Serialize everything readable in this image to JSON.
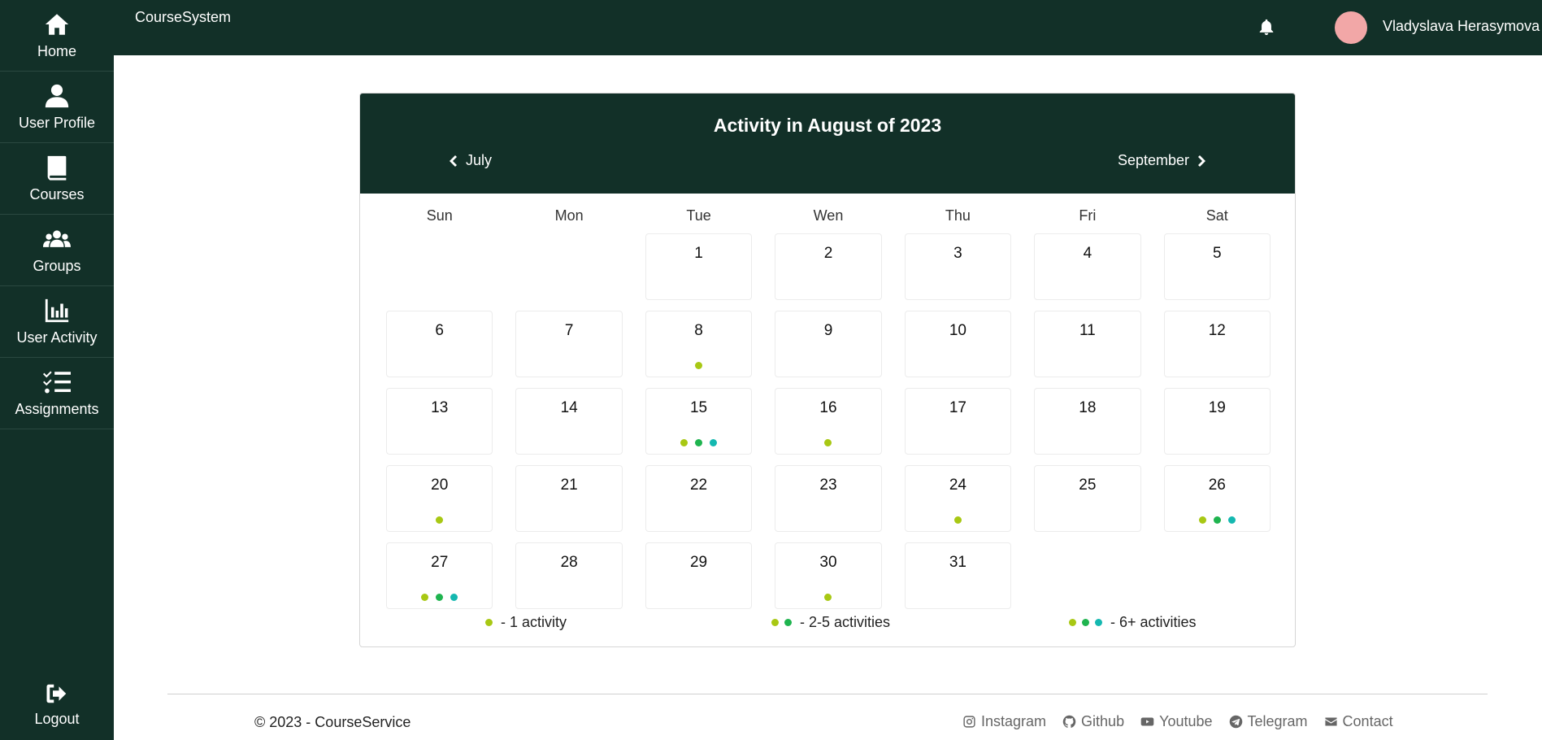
{
  "app": {
    "brand": "CourseSystem"
  },
  "sidebar": {
    "items": [
      {
        "label": "Home",
        "icon": "home-icon"
      },
      {
        "label": "User Profile",
        "icon": "user-icon"
      },
      {
        "label": "Courses",
        "icon": "book-icon"
      },
      {
        "label": "Groups",
        "icon": "users-icon"
      },
      {
        "label": "User Activity",
        "icon": "chart-icon"
      },
      {
        "label": "Assignments",
        "icon": "tasks-icon"
      }
    ],
    "logout": {
      "label": "Logout",
      "icon": "logout-icon"
    }
  },
  "header": {
    "user_name": "Vladyslava Herasymova",
    "bell_icon": "bell-icon"
  },
  "calendar": {
    "title": "Activity in August of 2023",
    "prev_month": "July",
    "next_month": "September",
    "weekdays": [
      "Sun",
      "Mon",
      "Tue",
      "Wen",
      "Thu",
      "Fri",
      "Sat"
    ],
    "leading_blank_days": 2,
    "days": [
      {
        "day": 1,
        "dots": 0
      },
      {
        "day": 2,
        "dots": 0
      },
      {
        "day": 3,
        "dots": 0
      },
      {
        "day": 4,
        "dots": 0
      },
      {
        "day": 5,
        "dots": 0
      },
      {
        "day": 6,
        "dots": 0
      },
      {
        "day": 7,
        "dots": 0
      },
      {
        "day": 8,
        "dots": 1
      },
      {
        "day": 9,
        "dots": 0
      },
      {
        "day": 10,
        "dots": 0
      },
      {
        "day": 11,
        "dots": 0
      },
      {
        "day": 12,
        "dots": 0
      },
      {
        "day": 13,
        "dots": 0
      },
      {
        "day": 14,
        "dots": 0
      },
      {
        "day": 15,
        "dots": 3
      },
      {
        "day": 16,
        "dots": 1
      },
      {
        "day": 17,
        "dots": 0
      },
      {
        "day": 18,
        "dots": 0
      },
      {
        "day": 19,
        "dots": 0
      },
      {
        "day": 20,
        "dots": 1
      },
      {
        "day": 21,
        "dots": 0
      },
      {
        "day": 22,
        "dots": 0
      },
      {
        "day": 23,
        "dots": 0
      },
      {
        "day": 24,
        "dots": 1
      },
      {
        "day": 25,
        "dots": 0
      },
      {
        "day": 26,
        "dots": 3
      },
      {
        "day": 27,
        "dots": 3
      },
      {
        "day": 28,
        "dots": 0
      },
      {
        "day": 29,
        "dots": 0
      },
      {
        "day": 30,
        "dots": 1
      },
      {
        "day": 31,
        "dots": 0
      }
    ],
    "dot_colors": [
      "#a8c814",
      "#1fb44f",
      "#14b8b0"
    ],
    "legend": [
      {
        "dots": 1,
        "text": "- 1 activity"
      },
      {
        "dots": 2,
        "text": "- 2-5 activities"
      },
      {
        "dots": 3,
        "text": "- 6+ activities"
      }
    ]
  },
  "footer": {
    "copyright": "© 2023 - CourseService",
    "links": [
      {
        "label": "Instagram",
        "icon": "instagram-icon"
      },
      {
        "label": "Github",
        "icon": "github-icon"
      },
      {
        "label": "Youtube",
        "icon": "youtube-icon"
      },
      {
        "label": "Telegram",
        "icon": "telegram-icon"
      },
      {
        "label": "Contact",
        "icon": "envelope-icon"
      }
    ]
  }
}
